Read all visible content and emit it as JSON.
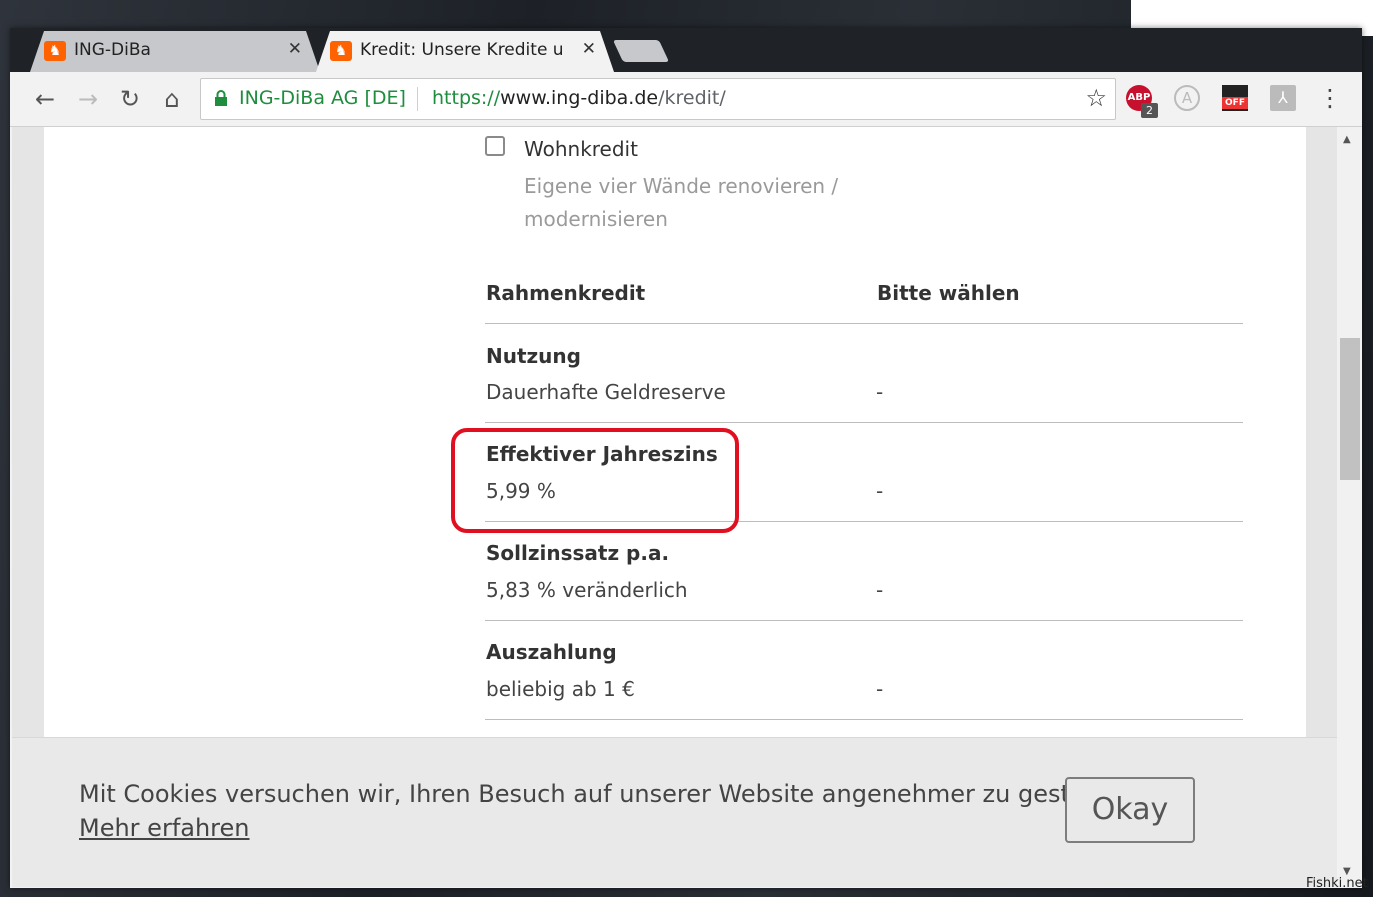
{
  "browser": {
    "tabs": [
      {
        "title": "ING-DiBa",
        "close": "✕"
      },
      {
        "title": "Kredit: Unsere Kredite un",
        "close": "✕"
      }
    ],
    "site_name": "ING-DiBa AG [DE]",
    "url": {
      "protocol": "https://",
      "host": "www.ing-diba.de",
      "path": "/kredit/"
    },
    "extensions": {
      "abp_label": "ABP",
      "abp_badge": "2",
      "a_label": "A",
      "off_label": "OFF"
    }
  },
  "page": {
    "checkbox": {
      "label": "Wohnkredit",
      "description_line1": "Eigene vier Wände renovieren /",
      "description_line2": "modernisieren",
      "checked": false
    },
    "table": {
      "header_left": "Rahmenkredit",
      "header_right": "Bitte wählen",
      "rows": [
        {
          "label": "Nutzung",
          "value": "Dauerhafte Geldreserve",
          "choice": "-"
        },
        {
          "label": "Effektiver Jahreszins",
          "value": "5,99 %",
          "choice": "-"
        },
        {
          "label": "Sollzinssatz p.a.",
          "value": "5,83 % veränderlich",
          "choice": "-"
        },
        {
          "label": "Auszahlung",
          "value": "beliebig ab 1 €",
          "choice": "-"
        }
      ]
    },
    "highlight_color": "#e01020"
  },
  "cookie_banner": {
    "text": "Mit Cookies versuchen wir, Ihren Besuch auf unserer Website angenehmer zu gestalten.",
    "link": "Mehr erfahren",
    "button": "Okay"
  },
  "watermark": "Fishki.net",
  "colors": {
    "brand": "#ff6200",
    "secure_green": "#1e8e3e"
  }
}
